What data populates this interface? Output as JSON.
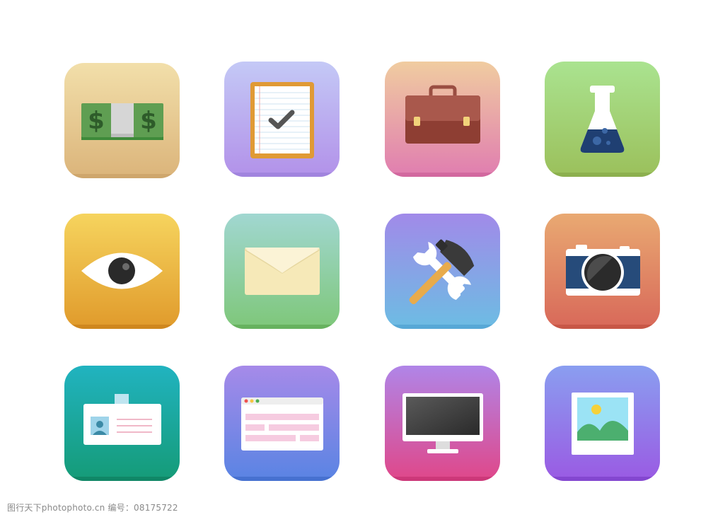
{
  "icons": [
    {
      "name": "money-icon",
      "colors": [
        "#f0dca5",
        "#dcb57a"
      ]
    },
    {
      "name": "checklist-icon",
      "colors": [
        "#c3c7f5",
        "#b493e9"
      ]
    },
    {
      "name": "briefcase-icon",
      "colors": [
        "#f0c8a0",
        "#e07fb0"
      ]
    },
    {
      "name": "flask-icon",
      "colors": [
        "#a8e28e",
        "#9cc25d"
      ]
    },
    {
      "name": "eye-icon",
      "colors": [
        "#f5d35d",
        "#e19a2c"
      ]
    },
    {
      "name": "envelope-icon",
      "colors": [
        "#9fd6cf",
        "#7fc77a"
      ]
    },
    {
      "name": "tools-icon",
      "colors": [
        "#a08ae8",
        "#6fbbe4"
      ]
    },
    {
      "name": "camera-icon",
      "colors": [
        "#e8a970",
        "#d9685a"
      ]
    },
    {
      "name": "id-card-icon",
      "colors": [
        "#20b2bf",
        "#149c78"
      ]
    },
    {
      "name": "browser-window-icon",
      "colors": [
        "#a58ae8",
        "#5a86e3"
      ]
    },
    {
      "name": "monitor-icon",
      "colors": [
        "#b183e8",
        "#e0488a"
      ]
    },
    {
      "name": "photo-icon",
      "colors": [
        "#8a9cf0",
        "#9a5ce4"
      ]
    }
  ],
  "watermark": "图行天下photophoto.cn  编号：08175722"
}
